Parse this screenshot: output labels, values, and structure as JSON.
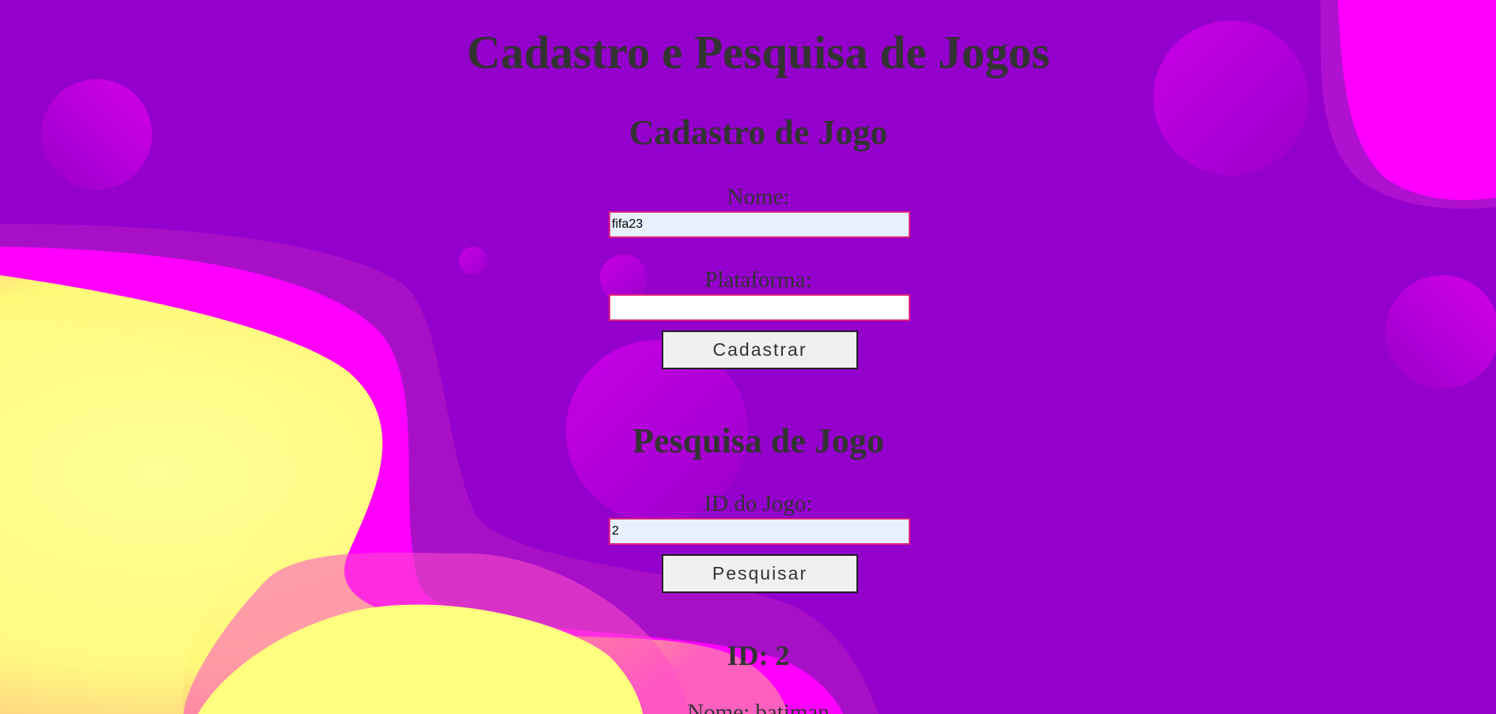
{
  "page": {
    "title": "Cadastro e Pesquisa de Jogos"
  },
  "cadastro": {
    "heading": "Cadastro de Jogo",
    "nome_label": "Nome:",
    "nome_value": "fifa23",
    "plataforma_label": "Plataforma:",
    "plataforma_value": "",
    "button_label": "Cadastrar"
  },
  "pesquisa": {
    "heading": "Pesquisa de Jogo",
    "id_label": "ID do Jogo:",
    "id_value": "2",
    "button_label": "Pesquisar"
  },
  "resultado": {
    "id_text": "ID: 2",
    "nome_text": "Nome: batiman"
  },
  "colors": {
    "background": "#9400cc",
    "magenta": "#ff00ff",
    "yellow": "#ffff8c",
    "text": "#333333",
    "input_border": "#e0207a"
  }
}
